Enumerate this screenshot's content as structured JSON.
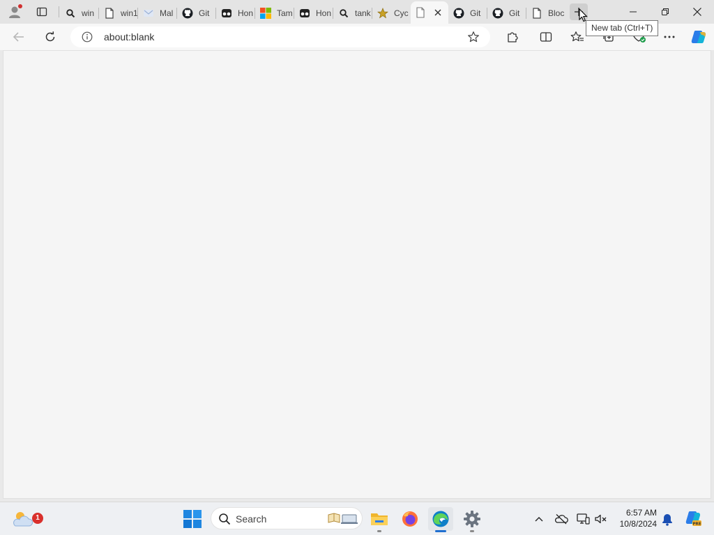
{
  "browser": {
    "tabs": [
      {
        "title": "win",
        "icon": "search-icon"
      },
      {
        "title": "win1",
        "icon": "page-icon"
      },
      {
        "title": "Mal",
        "icon": "mail-favicon"
      },
      {
        "title": "Git",
        "icon": "github-icon"
      },
      {
        "title": "Hon",
        "icon": "honey-favicon"
      },
      {
        "title": "Tam",
        "icon": "microsoft-icon"
      },
      {
        "title": "Hon",
        "icon": "honey-favicon"
      },
      {
        "title": "tank",
        "icon": "search-icon"
      },
      {
        "title": "Cyc",
        "icon": "star-favicon"
      },
      {
        "title": "",
        "icon": "page-icon",
        "active": true
      },
      {
        "title": "Git",
        "icon": "github-icon"
      },
      {
        "title": "Git",
        "icon": "github-icon"
      },
      {
        "title": "Bloc",
        "icon": "page-icon"
      }
    ],
    "newtab_tooltip": "New tab (Ctrl+T)",
    "address": {
      "url": "about:blank"
    }
  },
  "taskbar": {
    "search_placeholder": "Search",
    "weather_badge": "1",
    "clock": {
      "time": "6:57 AM",
      "date": "10/8/2024"
    },
    "pinned": [
      "file-explorer",
      "firefox",
      "edge",
      "settings"
    ]
  },
  "colors": {
    "accent": "#1f6fd0",
    "tab_strip": "#e4e4e4",
    "page_bg": "#f5f5f5"
  }
}
